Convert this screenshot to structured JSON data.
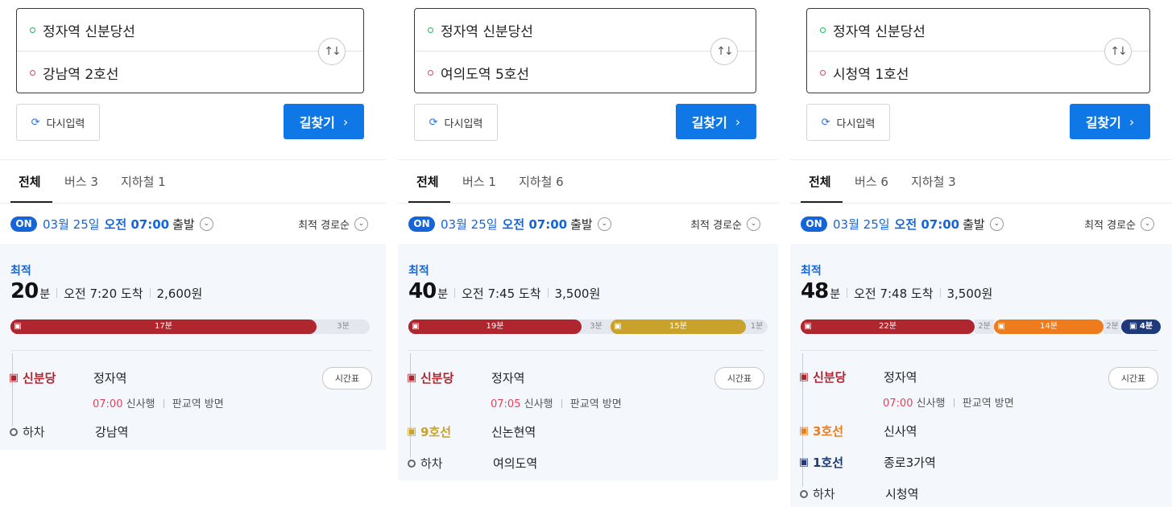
{
  "common": {
    "reset_label": "다시입력",
    "find_label": "길찾기",
    "tab_all": "전체",
    "on_badge": "ON",
    "date": "03월 25일",
    "ampm_time": "오전 07:00",
    "depart": "출발",
    "sort": "최적 경로순",
    "best": "최적",
    "unit_min": "분",
    "timetable": "시간표",
    "get_off": "하차"
  },
  "colors": {
    "sinbundang": "#b0262f",
    "line9": "#c9a22c",
    "line3": "#ef7c1c",
    "line1": "#1f3a7a",
    "accent": "#0f77e6"
  },
  "panels": [
    {
      "origin": "정자역 신분당선",
      "destination": "강남역 2호선",
      "tab_bus": "버스 3",
      "tab_subway": "지하철 1",
      "total_min": "20",
      "arrive": "오전 7:20 도착",
      "fare": "2,600원",
      "bar": {
        "segments": [
          {
            "label": "17분",
            "minutes": 17,
            "color": "#b0262f"
          }
        ],
        "gaps": [
          {
            "label": "3분",
            "minutes": 3
          }
        ]
      },
      "steps": [
        {
          "line": "신분당",
          "station": "정자역",
          "time": "07:00",
          "direction1": "신사행",
          "direction2": "판교역 방면"
        }
      ],
      "getoff_station": "강남역"
    },
    {
      "origin": "정자역 신분당선",
      "destination": "여의도역 5호선",
      "tab_bus": "버스 1",
      "tab_subway": "지하철 6",
      "total_min": "40",
      "arrive": "오전 7:45 도착",
      "fare": "3,500원",
      "bar": {
        "segments": [
          {
            "label": "19분",
            "minutes": 19,
            "color": "#b0262f"
          },
          {
            "label": "15분",
            "minutes": 15,
            "color": "#c9a22c"
          }
        ],
        "gaps": [
          {
            "label": "3분",
            "minutes": 3
          },
          {
            "label": "1분",
            "minutes": 1
          }
        ]
      },
      "steps": [
        {
          "line": "신분당",
          "station": "정자역",
          "time": "07:05",
          "direction1": "신사행",
          "direction2": "판교역 방면"
        },
        {
          "line": "9호선",
          "station": "신논현역"
        }
      ],
      "getoff_station": "여의도역"
    },
    {
      "origin": "정자역 신분당선",
      "destination": "시청역 1호선",
      "tab_bus": "버스 6",
      "tab_subway": "지하철 3",
      "total_min": "48",
      "arrive": "오전 7:48 도착",
      "fare": "3,500원",
      "bar": {
        "segments": [
          {
            "label": "22분",
            "minutes": 22,
            "color": "#b0262f"
          },
          {
            "label": "14분",
            "minutes": 14,
            "color": "#ef7c1c"
          },
          {
            "label": "4분",
            "minutes": 4,
            "color": "#1f3a7a"
          }
        ],
        "gaps": [
          {
            "label": "2분",
            "minutes": 2
          },
          {
            "label": "2분",
            "minutes": 2
          }
        ]
      },
      "steps": [
        {
          "line": "신분당",
          "station": "정자역",
          "time": "07:00",
          "direction1": "신사행",
          "direction2": "판교역 방면"
        },
        {
          "line": "3호선",
          "station": "신사역"
        },
        {
          "line": "1호선",
          "station": "종로3가역"
        }
      ],
      "getoff_station": "시청역"
    }
  ]
}
